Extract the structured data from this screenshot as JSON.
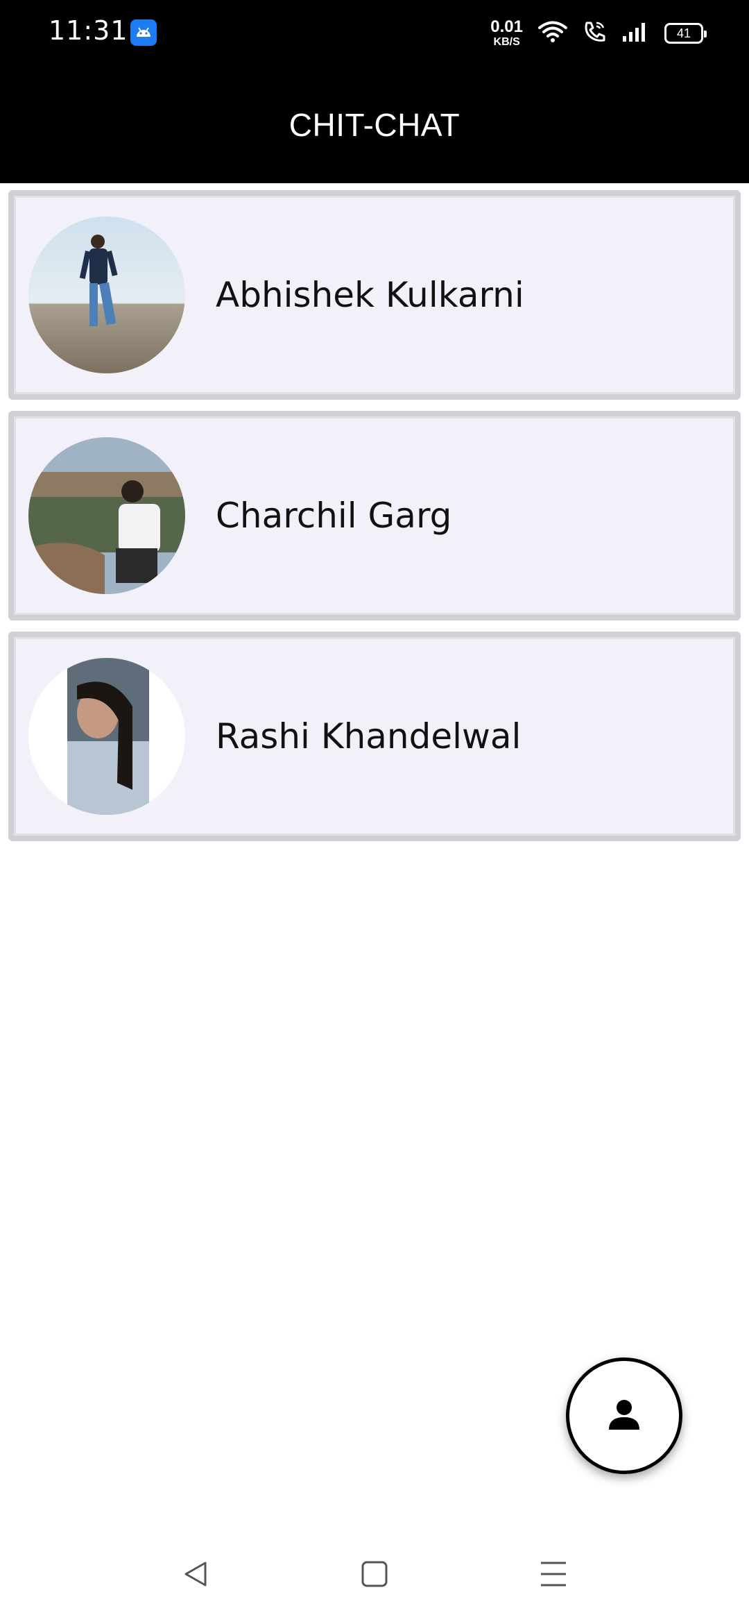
{
  "status_bar": {
    "time": "11:31",
    "net_speed_value": "0.01",
    "net_speed_unit": "KB/S",
    "battery_level": "41",
    "icons": [
      "android-app-icon",
      "wifi-icon",
      "wifi-call-icon",
      "signal-icon",
      "battery-icon"
    ]
  },
  "app_bar": {
    "title": "CHIT-CHAT"
  },
  "contacts": [
    {
      "name": "Abhishek Kulkarni",
      "avatar": "profile-photo"
    },
    {
      "name": "Charchil Garg",
      "avatar": "profile-photo"
    },
    {
      "name": "Rashi Khandelwal",
      "avatar": "profile-photo"
    }
  ],
  "fab": {
    "icon": "person-icon"
  },
  "nav_bar": {
    "icons": [
      "back-icon",
      "home-icon",
      "menu-icon"
    ]
  },
  "colors": {
    "header_bg": "#000000",
    "card_bg": "#f2f0f8",
    "card_border": "#d1ced6",
    "accent_app_icon": "#1e7cf2"
  }
}
